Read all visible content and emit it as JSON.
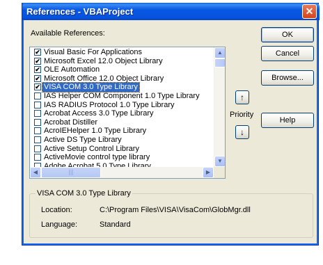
{
  "window": {
    "title": "References - VBAProject",
    "close_glyph": "✕"
  },
  "available_label": "Available References:",
  "buttons": {
    "ok": "OK",
    "cancel": "Cancel",
    "browse": "Browse...",
    "help": "Help"
  },
  "priority": {
    "label": "Priority",
    "up_glyph": "↑",
    "down_glyph": "↓"
  },
  "references": [
    {
      "label": "Visual Basic For Applications",
      "checked": true,
      "selected": false
    },
    {
      "label": "Microsoft Excel 12.0 Object Library",
      "checked": true,
      "selected": false
    },
    {
      "label": "OLE Automation",
      "checked": true,
      "selected": false
    },
    {
      "label": "Microsoft Office 12.0 Object Library",
      "checked": true,
      "selected": false
    },
    {
      "label": "VISA COM 3.0 Type Library",
      "checked": true,
      "selected": true
    },
    {
      "label": "IAS Helper COM Component 1.0 Type Library",
      "checked": false,
      "selected": false
    },
    {
      "label": "IAS RADIUS Protocol 1.0 Type Library",
      "checked": false,
      "selected": false
    },
    {
      "label": "Acrobat Access 3.0 Type Library",
      "checked": false,
      "selected": false
    },
    {
      "label": "Acrobat Distiller",
      "checked": false,
      "selected": false
    },
    {
      "label": "AcroIEHelper 1.0 Type Library",
      "checked": false,
      "selected": false
    },
    {
      "label": "Active DS Type Library",
      "checked": false,
      "selected": false
    },
    {
      "label": "Active Setup Control Library",
      "checked": false,
      "selected": false
    },
    {
      "label": "ActiveMovie control type library",
      "checked": false,
      "selected": false
    },
    {
      "label": "Adobe Acrobat 5.0 Type Library",
      "checked": false,
      "selected": false
    }
  ],
  "details": {
    "group_title": "VISA COM 3.0 Type Library",
    "location_label": "Location:",
    "location_value": "C:\\Program Files\\VISA\\VisaCom\\GlobMgr.dll",
    "language_label": "Language:",
    "language_value": "Standard"
  },
  "scroll_glyphs": {
    "up": "▲",
    "down": "▼",
    "left": "◀",
    "right": "▶",
    "grip": "|||"
  },
  "colors": {
    "title_bar": "#0958e3",
    "selection": "#316ac5",
    "dialog_bg": "#ece9d8"
  }
}
